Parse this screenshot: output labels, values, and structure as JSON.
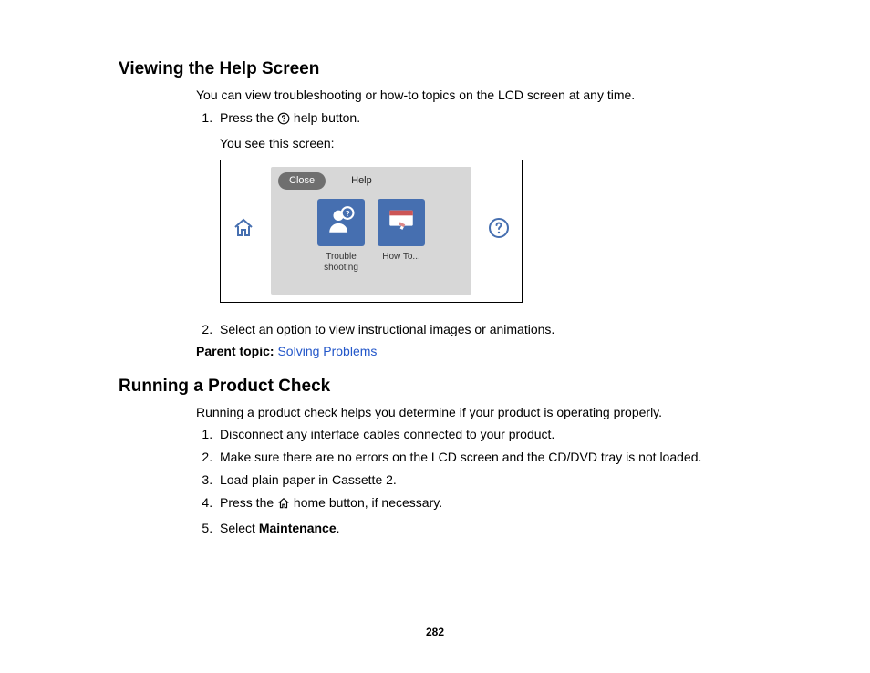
{
  "section1": {
    "heading": "Viewing the Help Screen",
    "intro": "You can view troubleshooting or how-to topics on the LCD screen at any time.",
    "step1_a": "Press the ",
    "step1_b": " help button.",
    "step1_sub": "You see this screen:",
    "step2": "Select an option to view instructional images or animations.",
    "parent_label": "Parent topic: ",
    "parent_link": "Solving Problems"
  },
  "lcd": {
    "close": "Close",
    "title": "Help",
    "tile1_line1": "Trouble",
    "tile1_line2": "shooting",
    "tile2": "How To..."
  },
  "section2": {
    "heading": "Running a Product Check",
    "intro": "Running a product check helps you determine if your product is operating properly.",
    "step1": "Disconnect any interface cables connected to your product.",
    "step2": "Make sure there are no errors on the LCD screen and the CD/DVD tray is not loaded.",
    "step3": "Load plain paper in Cassette 2.",
    "step4_a": "Press the ",
    "step4_b": " home button, if necessary.",
    "step5_a": "Select ",
    "step5_b": "Maintenance",
    "step5_c": "."
  },
  "page_number": "282"
}
